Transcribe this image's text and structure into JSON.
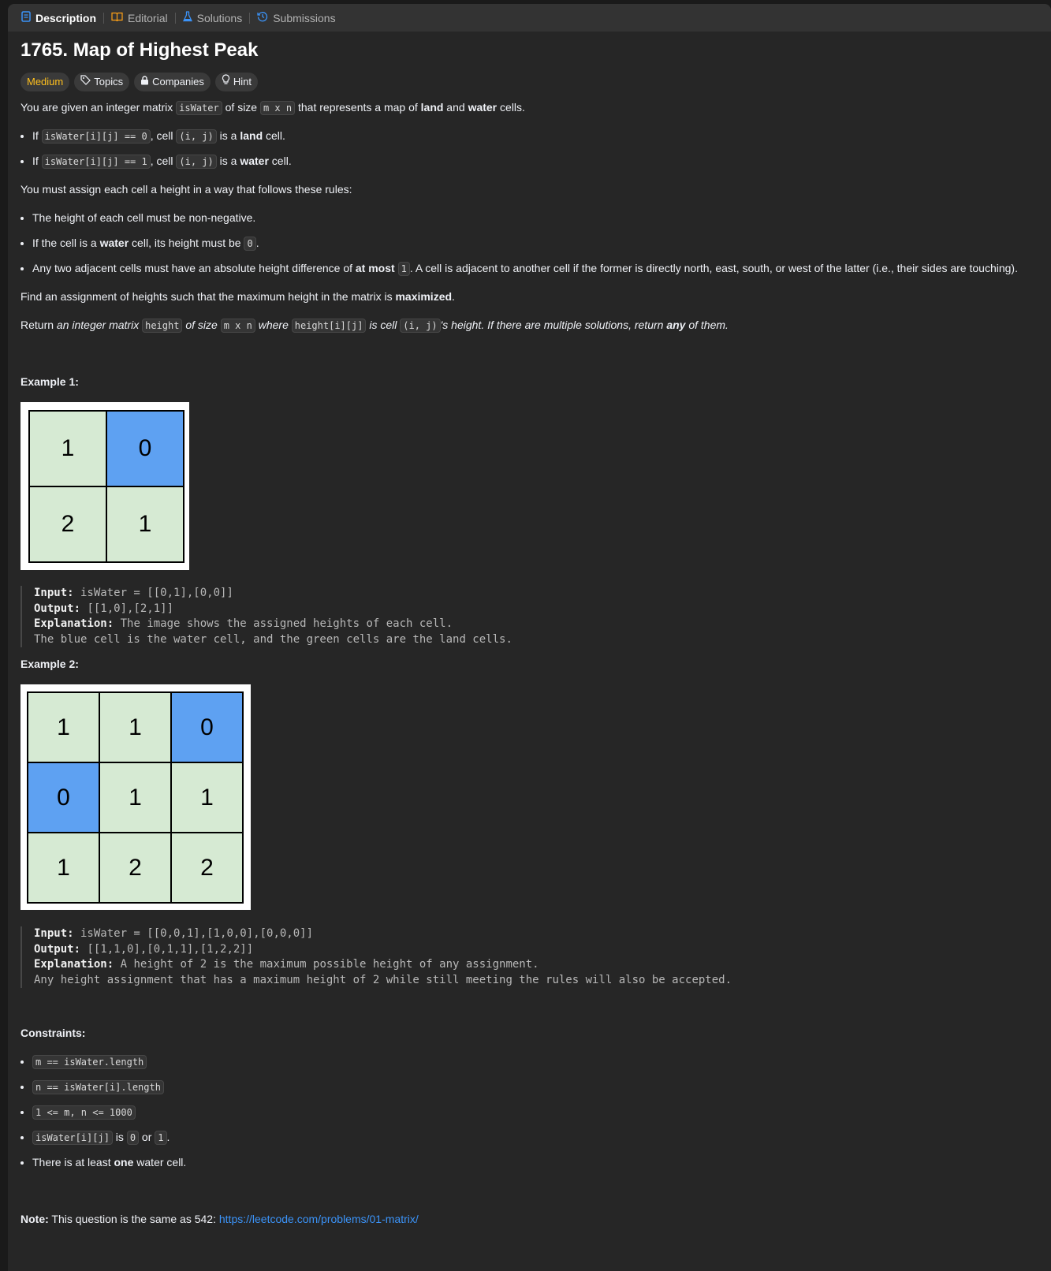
{
  "tabs": [
    {
      "label": "Description",
      "icon": "description-icon"
    },
    {
      "label": "Editorial",
      "icon": "book-icon"
    },
    {
      "label": "Solutions",
      "icon": "flask-icon"
    },
    {
      "label": "Submissions",
      "icon": "history-icon"
    }
  ],
  "title": "1765. Map of Highest Peak",
  "badges": {
    "difficulty": "Medium",
    "topics": "Topics",
    "companies": "Companies",
    "hint": "Hint"
  },
  "p1": {
    "a": "You are given an integer matrix ",
    "code1": "isWater",
    "b": " of size ",
    "code2": "m x n",
    "c": " that represents a map of ",
    "land": "land",
    "d": " and ",
    "water": "water",
    "e": " cells."
  },
  "rule1": {
    "a": "If ",
    "code1": "isWater[i][j] == 0",
    "b": ", cell ",
    "code2": "(i, j)",
    "c": " is a ",
    "strong": "land",
    "d": " cell."
  },
  "rule2": {
    "a": "If ",
    "code1": "isWater[i][j] == 1",
    "b": ", cell ",
    "code2": "(i, j)",
    "c": " is a ",
    "strong": "water",
    "d": " cell."
  },
  "p2": "You must assign each cell a height in a way that follows these rules:",
  "bullet1": "The height of each cell must be non-negative.",
  "bullet2": {
    "a": "If the cell is a ",
    "strong": "water",
    "b": " cell, its height must be ",
    "code": "0",
    "c": "."
  },
  "bullet3": {
    "a": "Any two adjacent cells must have an absolute height difference of ",
    "strong": "at most",
    "b": " ",
    "code": "1",
    "c": ". A cell is adjacent to another cell if the former is directly north, east, south, or west of the latter (i.e., their sides are touching)."
  },
  "p3": {
    "a": "Find an assignment of heights such that the maximum height in the matrix is ",
    "strong": "maximized",
    "b": "."
  },
  "p4": {
    "a": "Return ",
    "i1": "an integer matrix ",
    "code1": "height",
    "i2": " of size ",
    "code2": "m x n",
    "i3": " where ",
    "code3": "height[i][j]",
    "i4": " is cell ",
    "code4": "(i, j)",
    "i5": "'s height. If there are multiple solutions, return ",
    "strong": "any",
    "i6": " of them."
  },
  "example1": {
    "title": "Example 1:",
    "grid": [
      [
        {
          "v": "1",
          "w": false
        },
        {
          "v": "0",
          "w": true
        }
      ],
      [
        {
          "v": "2",
          "w": false
        },
        {
          "v": "1",
          "w": false
        }
      ]
    ],
    "input_label": "Input:",
    "input": " isWater = [[0,1],[0,0]]",
    "output_label": "Output:",
    "output": " [[1,0],[2,1]]",
    "expl_label": "Explanation:",
    "expl1": " The image shows the assigned heights of each cell.",
    "expl2": "The blue cell is the water cell, and the green cells are the land cells."
  },
  "example2": {
    "title": "Example 2:",
    "grid": [
      [
        {
          "v": "1",
          "w": false
        },
        {
          "v": "1",
          "w": false
        },
        {
          "v": "0",
          "w": true
        }
      ],
      [
        {
          "v": "0",
          "w": true
        },
        {
          "v": "1",
          "w": false
        },
        {
          "v": "1",
          "w": false
        }
      ],
      [
        {
          "v": "1",
          "w": false
        },
        {
          "v": "2",
          "w": false
        },
        {
          "v": "2",
          "w": false
        }
      ]
    ],
    "input_label": "Input:",
    "input": " isWater = [[0,0,1],[1,0,0],[0,0,0]]",
    "output_label": "Output:",
    "output": " [[1,1,0],[0,1,1],[1,2,2]]",
    "expl_label": "Explanation:",
    "expl1": " A height of 2 is the maximum possible height of any assignment.",
    "expl2": "Any height assignment that has a maximum height of 2 while still meeting the rules will also be accepted."
  },
  "constraints": {
    "title": "Constraints:",
    "c1": "m == isWater.length",
    "c2": "n == isWater[i].length",
    "c3": "1 <= m, n <= 1000",
    "c4": {
      "code1": "isWater[i][j]",
      "a": " is ",
      "code2": "0",
      "b": " or ",
      "code3": "1",
      "c": "."
    },
    "c5": {
      "a": "There is at least ",
      "strong": "one",
      "b": " water cell."
    }
  },
  "note": {
    "label": "Note:",
    "text": " This question is the same as 542: ",
    "link": "https://leetcode.com/problems/01-matrix/"
  },
  "colors": {
    "water": "#5ea1f2",
    "land": "#d6ead3",
    "medium": "#ffc01e",
    "link": "#3b93f8"
  }
}
